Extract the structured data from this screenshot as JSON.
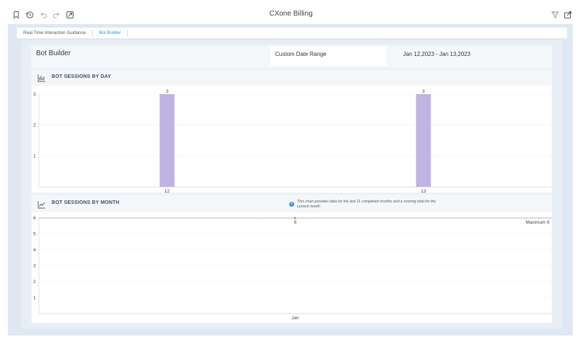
{
  "app": {
    "title": "CXone Billing"
  },
  "toolbar": {
    "left_icons": [
      "bookmark-icon",
      "history-icon",
      "undo-icon",
      "redo-icon",
      "reset-icon"
    ],
    "right_icons": [
      "filter-icon",
      "share-icon"
    ]
  },
  "tabs": [
    {
      "label": "Real Time Interaction Guidance",
      "active": false
    },
    {
      "label": "Bot Builder",
      "active": true
    }
  ],
  "header": {
    "title": "Bot Builder",
    "range_label": "Custom Date Range",
    "range_value": "Jan 12,2023 - Jan 13,2023"
  },
  "daily_card": {
    "title": "BOT SESSIONS BY DAY",
    "icon": "bar-chart-icon"
  },
  "monthly_card": {
    "title": "BOT SESSIONS BY MONTH",
    "icon": "line-chart-icon",
    "info_text": "This chart provides data for the last 11 completed months and a running total for the current month"
  },
  "colors": {
    "bar": "#bfb3e2",
    "accent": "#3b8fd9",
    "frame": "#dfe8f2"
  },
  "chart_data": [
    {
      "type": "bar",
      "categories": [
        "12",
        "13"
      ],
      "values": [
        3,
        3
      ],
      "data_labels": [
        "3",
        "3"
      ],
      "yticks": [
        "1",
        "2",
        "3"
      ],
      "ylim": [
        0,
        3
      ],
      "grid": true
    },
    {
      "type": "line",
      "categories": [
        "Jan"
      ],
      "values": [
        6
      ],
      "data_labels": [
        "6"
      ],
      "yticks": [
        "1",
        "2",
        "3",
        "4",
        "5",
        "6"
      ],
      "ylim": [
        0,
        6
      ],
      "max_label": "Maximum 6",
      "grid": true
    }
  ]
}
